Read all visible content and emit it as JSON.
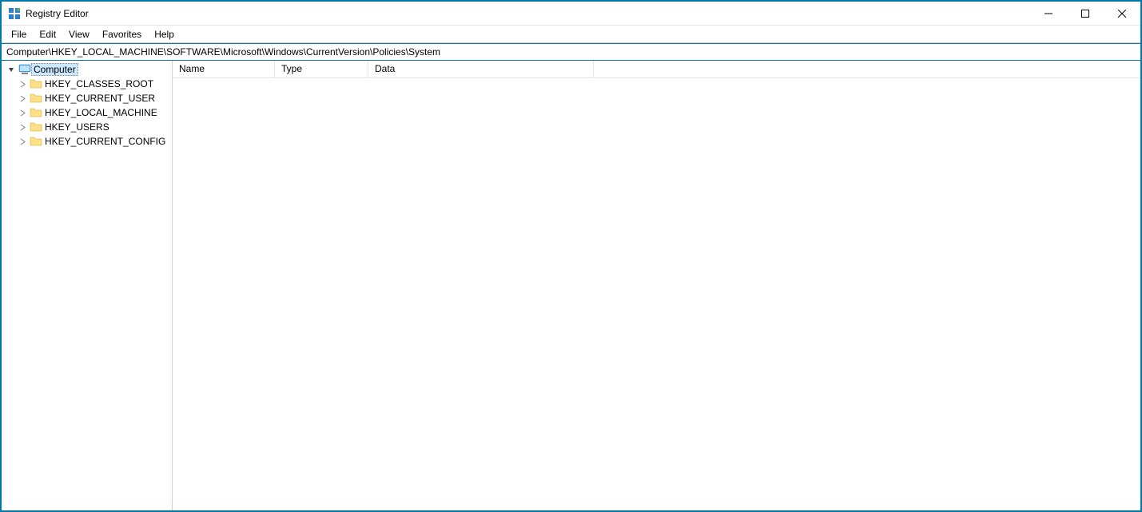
{
  "window": {
    "title": "Registry Editor"
  },
  "menu": {
    "items": [
      "File",
      "Edit",
      "View",
      "Favorites",
      "Help"
    ]
  },
  "address": {
    "path": "Computer\\HKEY_LOCAL_MACHINE\\SOFTWARE\\Microsoft\\Windows\\CurrentVersion\\Policies\\System"
  },
  "tree": {
    "root": {
      "label": "Computer",
      "expanded": true,
      "selected": true,
      "children": [
        {
          "label": "HKEY_CLASSES_ROOT"
        },
        {
          "label": "HKEY_CURRENT_USER"
        },
        {
          "label": "HKEY_LOCAL_MACHINE"
        },
        {
          "label": "HKEY_USERS"
        },
        {
          "label": "HKEY_CURRENT_CONFIG"
        }
      ]
    }
  },
  "list": {
    "columns": [
      "Name",
      "Type",
      "Data"
    ],
    "rows": []
  }
}
